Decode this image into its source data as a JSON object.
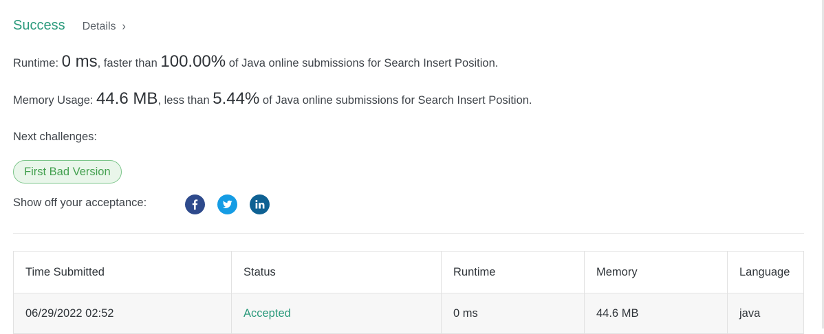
{
  "header": {
    "status": "Success",
    "details_label": "Details",
    "details_chevron": "›"
  },
  "runtime": {
    "label": "Runtime:",
    "value": "0 ms",
    "mid": ", faster than",
    "percent": "100.00%",
    "suffix": "of Java online submissions for Search Insert Position."
  },
  "memory": {
    "label": "Memory Usage:",
    "value": "44.6 MB",
    "mid": ", less than",
    "percent": "5.44%",
    "suffix": "of Java online submissions for Search Insert Position."
  },
  "next": {
    "label": "Next challenges:",
    "challenges": [
      "First Bad Version"
    ]
  },
  "share": {
    "label": "Show off your acceptance:",
    "icons": [
      "facebook-icon",
      "twitter-icon",
      "linkedin-icon"
    ]
  },
  "table": {
    "headers": [
      "Time Submitted",
      "Status",
      "Runtime",
      "Memory",
      "Language"
    ],
    "rows": [
      [
        "06/29/2022 02:52",
        "Accepted",
        "0 ms",
        "44.6 MB",
        "java"
      ]
    ]
  },
  "colors": {
    "accent_green": "#2b9a7c",
    "pill_green": "#43a04f",
    "facebook": "#2e4a8c",
    "twitter": "#159ce4",
    "linkedin": "#0e6193"
  }
}
